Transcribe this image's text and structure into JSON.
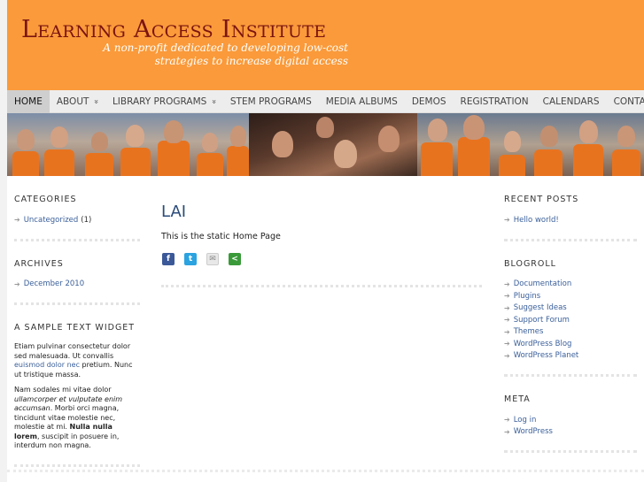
{
  "header": {
    "title": "Learning Access Institute",
    "tagline": "A non-profit dedicated to developing low-cost strategies to increase digital access"
  },
  "nav": {
    "items": [
      {
        "label": "HOME",
        "active": true,
        "submenu": false
      },
      {
        "label": "ABOUT",
        "active": false,
        "submenu": true
      },
      {
        "label": "LIBRARY PROGRAMS",
        "active": false,
        "submenu": true
      },
      {
        "label": "STEM PROGRAMS",
        "active": false,
        "submenu": false
      },
      {
        "label": "MEDIA ALBUMS",
        "active": false,
        "submenu": false
      },
      {
        "label": "DEMOS",
        "active": false,
        "submenu": false
      },
      {
        "label": "REGISTRATION",
        "active": false,
        "submenu": false
      },
      {
        "label": "CALENDARS",
        "active": false,
        "submenu": false
      },
      {
        "label": "CONTACT US",
        "active": false,
        "submenu": false
      }
    ],
    "submenu_glyph": "»"
  },
  "sidebar_left": {
    "categories": {
      "title": "CATEGORIES",
      "items": [
        {
          "label": "Uncategorized",
          "count": "(1)"
        }
      ]
    },
    "archives": {
      "title": "ARCHIVES",
      "items": [
        {
          "label": "December 2010"
        }
      ]
    },
    "text_widget": {
      "title": "A SAMPLE TEXT WIDGET",
      "p1_a": "Etiam pulvinar consectetur dolor sed malesuada. Ut convallis ",
      "p1_link": "euismod dolor nec",
      "p1_b": " pretium. Nunc ut tristique massa.",
      "p2_a": "Nam sodales mi vitae dolor ",
      "p2_em": "ullamcorper et vulputate enim accumsan",
      "p2_b": ". Morbi orci magna, tincidunt vitae molestie nec, molestie at mi. ",
      "p2_strong": "Nulla nulla lorem",
      "p2_c": ", suscipit in posuere in, interdum non magna."
    }
  },
  "content": {
    "title": "LAI",
    "body": "This is the static Home Page",
    "share": [
      {
        "icon": "facebook-icon",
        "glyph": "f",
        "color": "#3b5998"
      },
      {
        "icon": "twitter-icon",
        "glyph": "t",
        "color": "#2aa3e0"
      },
      {
        "icon": "email-icon",
        "glyph": "✉",
        "color": "#e8e8e8"
      },
      {
        "icon": "share-icon",
        "glyph": "<",
        "color": "#3a9a3a"
      }
    ]
  },
  "sidebar_right": {
    "recent_posts": {
      "title": "RECENT POSTS",
      "items": [
        {
          "label": "Hello world!"
        }
      ]
    },
    "blogroll": {
      "title": "BLOGROLL",
      "items": [
        {
          "label": "Documentation"
        },
        {
          "label": "Plugins"
        },
        {
          "label": "Suggest Ideas"
        },
        {
          "label": "Support Forum"
        },
        {
          "label": "Themes"
        },
        {
          "label": "WordPress Blog"
        },
        {
          "label": "WordPress Planet"
        }
      ]
    },
    "meta": {
      "title": "META",
      "items": [
        {
          "label": "Log in"
        },
        {
          "label": "WordPress"
        }
      ]
    }
  },
  "colors": {
    "header_bg": "#fa9a3a",
    "title_color": "#7b1410",
    "link_color": "#3a5f9a",
    "nav_bg": "#ededed"
  }
}
